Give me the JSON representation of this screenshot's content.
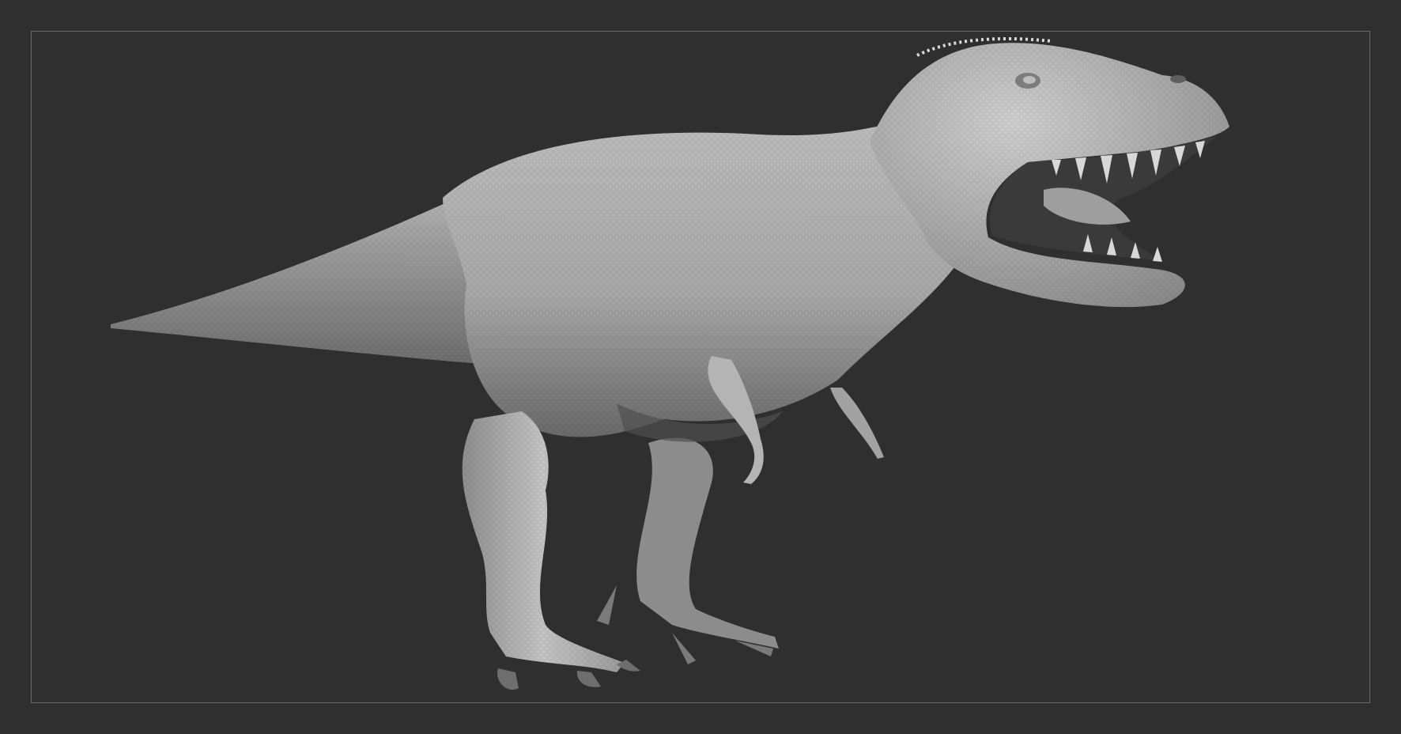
{
  "scene": {
    "subject": "sculpted-dinosaur-model",
    "colors": {
      "background": "#2f2f2f",
      "frame_border": "#6a6a6a",
      "clay_light": "#c9c9c9",
      "clay_mid": "#9a9a9a",
      "clay_dark": "#5a5a5a"
    }
  }
}
